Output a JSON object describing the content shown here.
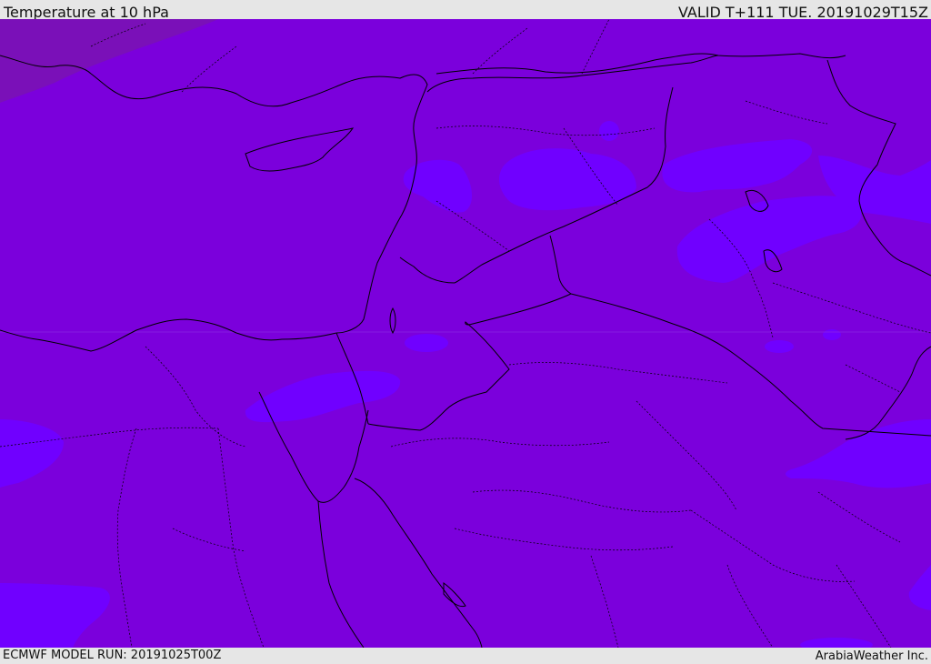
{
  "header": {
    "title": "Temperature at 10 hPa",
    "valid_time": "VALID T+111 TUE. 20191029T15Z"
  },
  "footer": {
    "model_run": "ECMWF MODEL RUN: 20191025T00Z",
    "credit": "ArabiaWeather Inc."
  },
  "map": {
    "variable": "temperature",
    "level": "10 hPa",
    "colors": {
      "base_field": "#7b00dc",
      "warmer_patches": "#7000ff",
      "cold_corner": "#7a10b8",
      "borders": "#000000"
    },
    "features": [
      "coastlines",
      "country borders",
      "province borders (dotted)"
    ]
  }
}
